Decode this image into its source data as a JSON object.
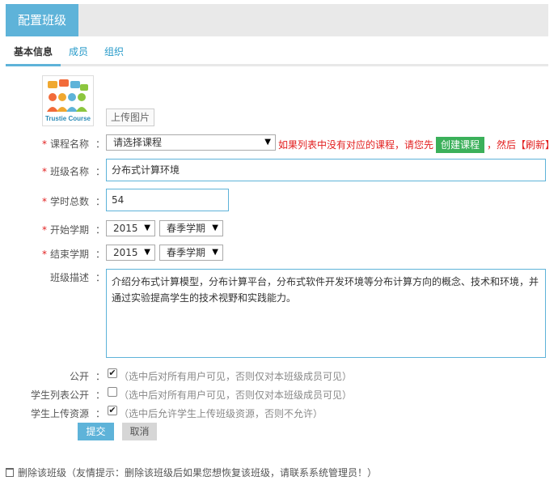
{
  "header": {
    "title": "配置班级"
  },
  "tabs": [
    {
      "label": "基本信息"
    },
    {
      "label": "成员"
    },
    {
      "label": "组织"
    }
  ],
  "logo": {
    "text": "Trustie Course"
  },
  "upload_label": "上传图片",
  "form": {
    "colon": "：",
    "required_mark": "*",
    "course": {
      "label": "课程名称",
      "value": "请选择课程",
      "hint_prefix": "如果列表中没有对应的课程，请您先",
      "create_label": "创建课程",
      "hint_suffix": "，然后【刷新】"
    },
    "class_name": {
      "label": "班级名称",
      "value": "分布式计算环境"
    },
    "hours": {
      "label": "学时总数",
      "value": "54"
    },
    "start_term": {
      "label": "开始学期",
      "year": "2015",
      "season": "春季学期"
    },
    "end_term": {
      "label": "结束学期",
      "year": "2015",
      "season": "春季学期"
    },
    "description": {
      "label": "班级描述",
      "value": "介绍分布式计算模型，分布计算平台，分布式软件开发环境等分布计算方向的概念、技术和环境，并通过实验提高学生的技术视野和实践能力。"
    },
    "public": {
      "label": "公开",
      "checked": true,
      "note": "（选中后对所有用户可见，否则仅对本班级成员可见）"
    },
    "student_list_public": {
      "label": "学生列表公开",
      "checked": false,
      "note": "（选中后对所有用户可见，否则仅对本班级成员可见）"
    },
    "student_upload": {
      "label": "学生上传资源",
      "checked": true,
      "note": "（选中后允许学生上传班级资源，否则不允许）"
    },
    "submit_label": "提交",
    "cancel_label": "取消"
  },
  "footer": {
    "delete_label": "删除该班级",
    "delete_note": "（友情提示：删除该班级后如果您想恢复该班级，请联系系统管理员！）"
  },
  "colors": {
    "accent": "#5eb3d9",
    "link": "#269ac9",
    "danger": "#e21f1f",
    "success": "#3bb05a"
  },
  "icons": {
    "checkbox_checked": "✔",
    "dropdown": "▼",
    "delete": "trash-icon"
  }
}
